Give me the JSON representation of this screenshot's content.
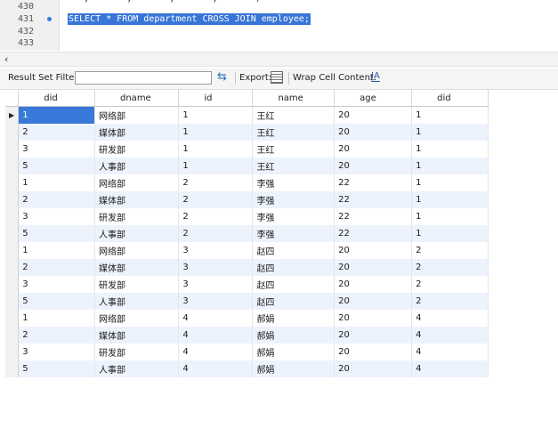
{
  "editor": {
    "lines": [
      {
        "number": "430",
        "text": ""
      },
      {
        "number": "431",
        "text": "SELECT * FROM department CROSS JOIN employee;",
        "selected": true
      },
      {
        "number": "432",
        "text": ""
      },
      {
        "number": "433",
        "text": ""
      }
    ],
    "partial_top_text": "  ', '    ', '    ', '    ',      ')"
  },
  "toolbar": {
    "filter_label": "Result Set Filter:",
    "filter_value": "",
    "export_label": "Export:",
    "wrap_label": "Wrap Cell Content:"
  },
  "grid": {
    "columns": [
      "did",
      "dname",
      "id",
      "name",
      "age",
      "did"
    ],
    "rows": [
      [
        "1",
        "网络部",
        "1",
        "王红",
        "20",
        "1"
      ],
      [
        "2",
        "媒体部",
        "1",
        "王红",
        "20",
        "1"
      ],
      [
        "3",
        "研发部",
        "1",
        "王红",
        "20",
        "1"
      ],
      [
        "5",
        "人事部",
        "1",
        "王红",
        "20",
        "1"
      ],
      [
        "1",
        "网络部",
        "2",
        "李强",
        "22",
        "1"
      ],
      [
        "2",
        "媒体部",
        "2",
        "李强",
        "22",
        "1"
      ],
      [
        "3",
        "研发部",
        "2",
        "李强",
        "22",
        "1"
      ],
      [
        "5",
        "人事部",
        "2",
        "李强",
        "22",
        "1"
      ],
      [
        "1",
        "网络部",
        "3",
        "赵四",
        "20",
        "2"
      ],
      [
        "2",
        "媒体部",
        "3",
        "赵四",
        "20",
        "2"
      ],
      [
        "3",
        "研发部",
        "3",
        "赵四",
        "20",
        "2"
      ],
      [
        "5",
        "人事部",
        "3",
        "赵四",
        "20",
        "2"
      ],
      [
        "1",
        "网络部",
        "4",
        "郝娟",
        "20",
        "4"
      ],
      [
        "2",
        "媒体部",
        "4",
        "郝娟",
        "20",
        "4"
      ],
      [
        "3",
        "研发部",
        "4",
        "郝娟",
        "20",
        "4"
      ],
      [
        "5",
        "人事部",
        "4",
        "郝娟",
        "20",
        "4"
      ]
    ],
    "current_row_marker": "▶"
  },
  "colors": {
    "selection": "#3875d7",
    "alt_row": "#edf3fd",
    "gutter_bullet": "#2f7fd8"
  }
}
